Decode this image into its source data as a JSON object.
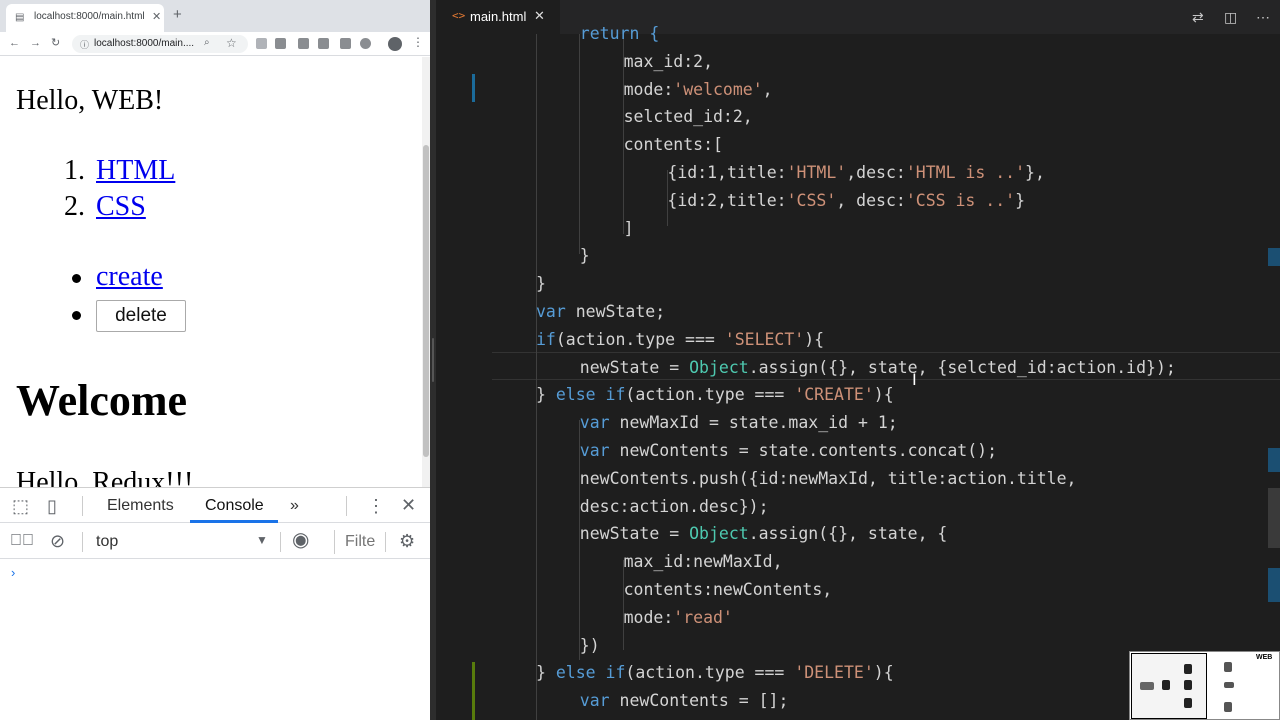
{
  "browser": {
    "tab_title": "localhost:8000/main.html",
    "url": "localhost:8000/main....",
    "page": {
      "heading": "Hello, WEB!",
      "list": [
        {
          "number": "1.",
          "label": "HTML"
        },
        {
          "number": "2.",
          "label": "CSS"
        }
      ],
      "create_label": "create",
      "delete_label": "delete",
      "welcome": "Welcome",
      "redux_text": "Hello, Redux!!!"
    },
    "devtools": {
      "tabs": [
        "Elements",
        "Console"
      ],
      "active_tab": "Console",
      "more": "»",
      "context": "top",
      "filter_placeholder": "Filte",
      "prompt": "›"
    }
  },
  "editor": {
    "file_tab": "main.html",
    "file_icon": "<>",
    "lines": [
      {
        "indent": 4,
        "segments": [
          {
            "t": "return {",
            "c": "k"
          }
        ]
      },
      {
        "indent": 8,
        "segments": [
          {
            "t": "max_id:2,",
            "c": "p"
          }
        ]
      },
      {
        "indent": 8,
        "segments": [
          {
            "t": "mode:",
            "c": "p"
          },
          {
            "t": "'welcome'",
            "c": "s"
          },
          {
            "t": ",",
            "c": "p"
          }
        ]
      },
      {
        "indent": 8,
        "segments": [
          {
            "t": "selcted_id:2,",
            "c": "p"
          }
        ]
      },
      {
        "indent": 8,
        "segments": [
          {
            "t": "contents:[",
            "c": "p"
          }
        ]
      },
      {
        "indent": 12,
        "segments": [
          {
            "t": "{id:1,title:",
            "c": "p"
          },
          {
            "t": "'HTML'",
            "c": "s"
          },
          {
            "t": ",desc:",
            "c": "p"
          },
          {
            "t": "'HTML is ..'",
            "c": "s"
          },
          {
            "t": "},",
            "c": "p"
          }
        ]
      },
      {
        "indent": 12,
        "segments": [
          {
            "t": "{id:2,title:",
            "c": "p"
          },
          {
            "t": "'CSS'",
            "c": "s"
          },
          {
            "t": ", desc:",
            "c": "p"
          },
          {
            "t": "'CSS is ..'",
            "c": "s"
          },
          {
            "t": "}",
            "c": "p"
          }
        ]
      },
      {
        "indent": 8,
        "segments": [
          {
            "t": "]",
            "c": "p"
          }
        ]
      },
      {
        "indent": 4,
        "segments": [
          {
            "t": "}",
            "c": "p"
          }
        ]
      },
      {
        "indent": 0,
        "segments": [
          {
            "t": "}",
            "c": "p"
          }
        ]
      },
      {
        "indent": 0,
        "segments": [
          {
            "t": "var",
            "c": "k"
          },
          {
            "t": " newState;",
            "c": "p"
          }
        ]
      },
      {
        "indent": 0,
        "segments": [
          {
            "t": "if",
            "c": "k"
          },
          {
            "t": "(action.type === ",
            "c": "p"
          },
          {
            "t": "'SELECT'",
            "c": "s"
          },
          {
            "t": "){",
            "c": "p"
          }
        ]
      },
      {
        "indent": 4,
        "segments": [
          {
            "t": "newState = ",
            "c": "p"
          },
          {
            "t": "Object",
            "c": "c"
          },
          {
            "t": ".assign({}, state, {selcted_id:action.id});",
            "c": "p"
          }
        ]
      },
      {
        "indent": 0,
        "segments": [
          {
            "t": "} ",
            "c": "p"
          },
          {
            "t": "else if",
            "c": "k"
          },
          {
            "t": "(action.type === ",
            "c": "p"
          },
          {
            "t": "'CREATE'",
            "c": "s"
          },
          {
            "t": "){",
            "c": "p"
          }
        ]
      },
      {
        "indent": 4,
        "segments": [
          {
            "t": "var",
            "c": "k"
          },
          {
            "t": " newMaxId = state.max_id + 1;",
            "c": "p"
          }
        ]
      },
      {
        "indent": 4,
        "segments": [
          {
            "t": "var",
            "c": "k"
          },
          {
            "t": " newContents = state.contents.concat();",
            "c": "p"
          }
        ]
      },
      {
        "indent": 4,
        "segments": [
          {
            "t": "newContents.push({id:newMaxId, title:action.title,",
            "c": "p"
          }
        ]
      },
      {
        "indent": 4,
        "segments": [
          {
            "t": "desc:action.desc});",
            "c": "p"
          }
        ]
      },
      {
        "indent": 4,
        "segments": [
          {
            "t": "newState = ",
            "c": "p"
          },
          {
            "t": "Object",
            "c": "c"
          },
          {
            "t": ".assign({}, state, {",
            "c": "p"
          }
        ]
      },
      {
        "indent": 8,
        "segments": [
          {
            "t": "max_id:newMaxId,",
            "c": "p"
          }
        ]
      },
      {
        "indent": 8,
        "segments": [
          {
            "t": "contents:newContents,",
            "c": "p"
          }
        ]
      },
      {
        "indent": 8,
        "segments": [
          {
            "t": "mode:",
            "c": "p"
          },
          {
            "t": "'read'",
            "c": "s"
          }
        ]
      },
      {
        "indent": 4,
        "segments": [
          {
            "t": "})",
            "c": "p"
          }
        ]
      },
      {
        "indent": 0,
        "segments": [
          {
            "t": "} ",
            "c": "p"
          },
          {
            "t": "else if",
            "c": "k"
          },
          {
            "t": "(action.type === ",
            "c": "p"
          },
          {
            "t": "'DELETE'",
            "c": "s"
          },
          {
            "t": "){",
            "c": "p"
          }
        ]
      },
      {
        "indent": 4,
        "segments": [
          {
            "t": "var",
            "c": "k"
          },
          {
            "t": " newContents = [];",
            "c": "p"
          }
        ]
      }
    ]
  },
  "overlay": {
    "label": "WEB"
  },
  "colors": {
    "keyword": "#569cd6",
    "string": "#ce9178",
    "class": "#4ec9b0",
    "link": "#0000ee",
    "active_tab_underline": "#1a73e8"
  }
}
